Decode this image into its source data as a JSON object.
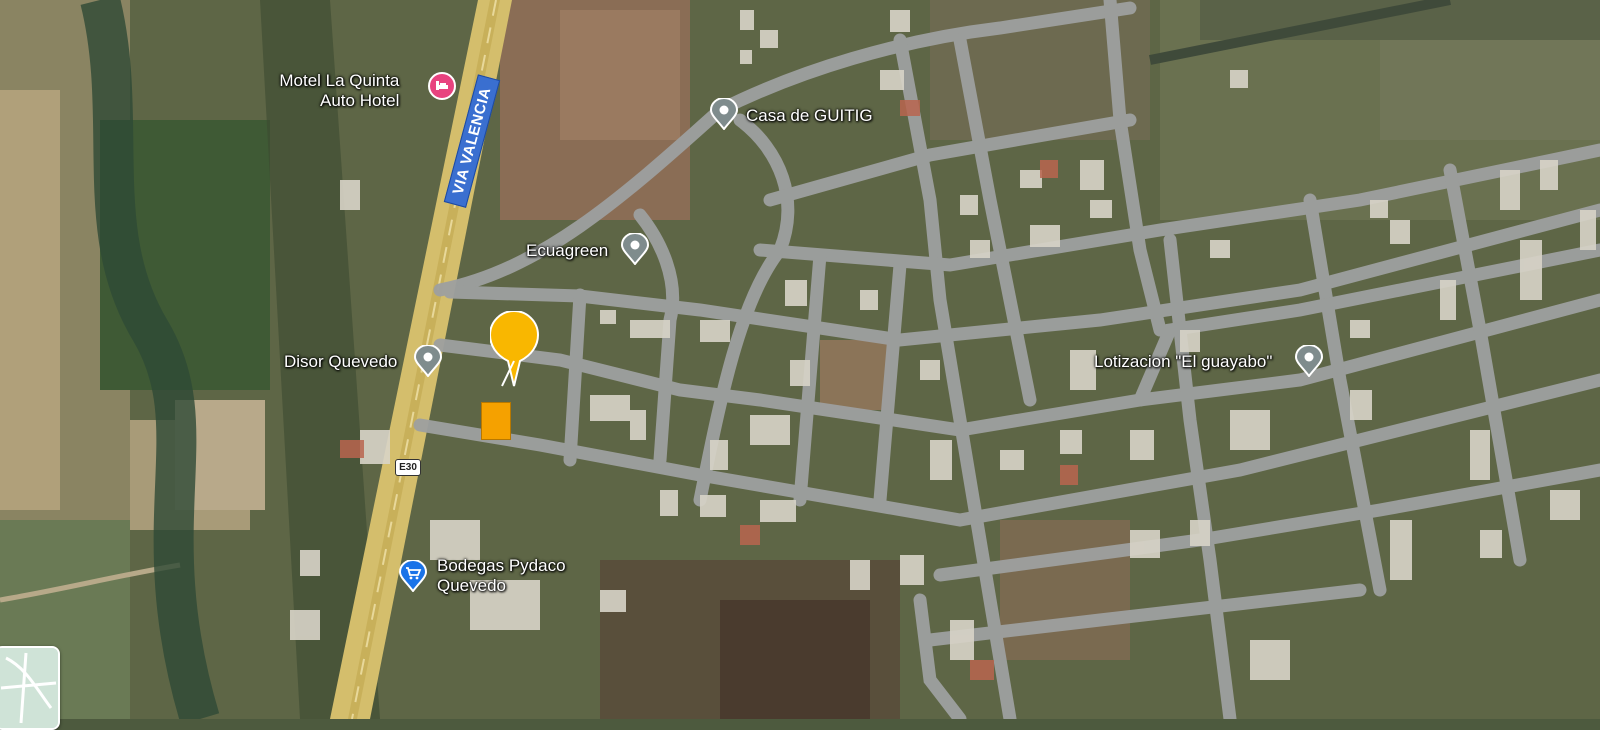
{
  "map": {
    "type": "satellite",
    "road": {
      "name": "VIA VALENCIA",
      "shield": "E30",
      "color": "#3a6fd0"
    },
    "places": [
      {
        "id": "motel",
        "name_line1": "Motel La Quinta",
        "name_line2": "Auto Hotel",
        "icon": "hotel-pin-icon",
        "color": "#e8437f"
      },
      {
        "id": "guitig",
        "name": "Casa de GUITIG",
        "icon": "place-pin-icon",
        "color": "#7f8c8d"
      },
      {
        "id": "ecuagreen",
        "name": "Ecuagreen",
        "icon": "place-pin-icon",
        "color": "#7f8c8d"
      },
      {
        "id": "disor",
        "name": "Disor Quevedo",
        "icon": "place-pin-icon",
        "color": "#7f8c8d"
      },
      {
        "id": "lotizacion",
        "name": "Lotizacion \"El guayabo\"",
        "icon": "place-pin-icon",
        "color": "#7f8c8d"
      },
      {
        "id": "bodegas",
        "name_line1": "Bodegas Pydaco",
        "name_line2": "Quevedo",
        "icon": "shopping-cart-pin-icon",
        "color": "#1a73e8"
      }
    ],
    "selected": {
      "marker_icon": "location-marker-icon",
      "marker_color": "#f9b700",
      "lot_color": "#f5a100"
    },
    "minimap": {
      "label": "",
      "icon": "layers-thumbnail"
    }
  }
}
